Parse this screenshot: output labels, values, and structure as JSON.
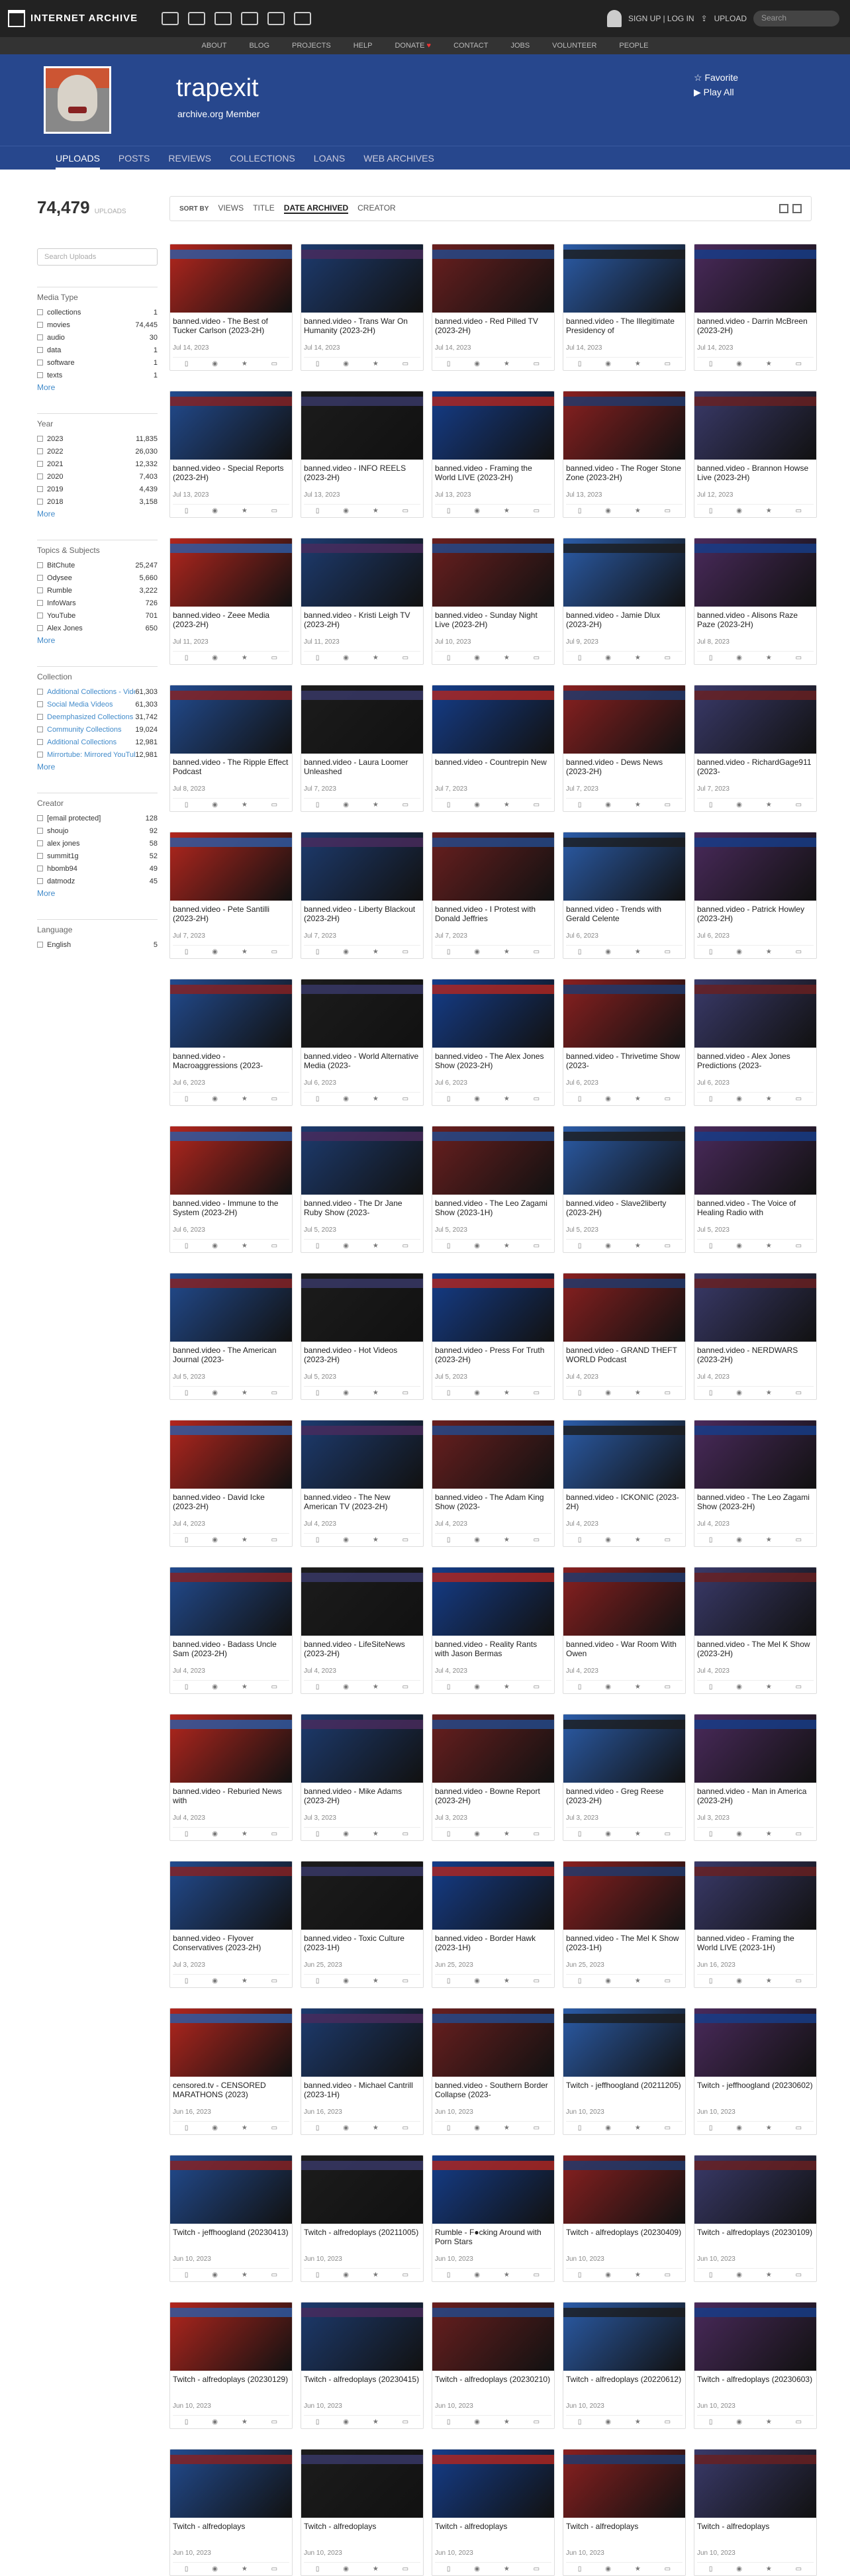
{
  "topnav": {
    "logo": "INTERNET ARCHIVE",
    "signup": "SIGN UP | LOG IN",
    "upload": "UPLOAD",
    "search_placeholder": "Search"
  },
  "subnav": [
    "ABOUT",
    "BLOG",
    "PROJECTS",
    "HELP",
    "DONATE",
    "CONTACT",
    "JOBS",
    "VOLUNTEER",
    "PEOPLE"
  ],
  "profile": {
    "name": "trapexit",
    "subtitle": "archive.org Member",
    "favorite": "☆ Favorite",
    "play_all": "▶ Play All"
  },
  "tabs": [
    "UPLOADS",
    "POSTS",
    "REVIEWS",
    "COLLECTIONS",
    "LOANS",
    "WEB ARCHIVES"
  ],
  "left": {
    "count": "74,479",
    "count_label": "UPLOADS",
    "search_placeholder": "Search Uploads",
    "facets": [
      {
        "title": "Media Type",
        "rows": [
          [
            "collections",
            "1"
          ],
          [
            "movies",
            "74,445"
          ],
          [
            "audio",
            "30"
          ],
          [
            "data",
            "1"
          ],
          [
            "software",
            "1"
          ],
          [
            "texts",
            "1"
          ]
        ],
        "more": "More"
      },
      {
        "title": "Year",
        "rows": [
          [
            "2023",
            "11,835"
          ],
          [
            "2022",
            "26,030"
          ],
          [
            "2021",
            "12,332"
          ],
          [
            "2020",
            "7,403"
          ],
          [
            "2019",
            "4,439"
          ],
          [
            "2018",
            "3,158"
          ]
        ],
        "more": "More"
      },
      {
        "title": "Topics & Subjects",
        "rows": [
          [
            "BitChute",
            "25,247"
          ],
          [
            "Odysee",
            "5,660"
          ],
          [
            "Rumble",
            "3,222"
          ],
          [
            "InfoWars",
            "726"
          ],
          [
            "YouTube",
            "701"
          ],
          [
            "Alex Jones",
            "650"
          ]
        ],
        "more": "More"
      },
      {
        "title": "Collection",
        "rows": [
          [
            "Additional Collections - Video",
            "61,303"
          ],
          [
            "Social Media Videos",
            "61,303"
          ],
          [
            "Deemphasized Collections",
            "31,742"
          ],
          [
            "Community Collections",
            "19,024"
          ],
          [
            "Additional Collections",
            "12,981"
          ],
          [
            "Mirrortube: Mirrored YouTube Videos",
            "12,981"
          ]
        ],
        "more": "More",
        "link": true
      },
      {
        "title": "Creator",
        "rows": [
          [
            "[email protected]",
            "128"
          ],
          [
            "shoujo",
            "92"
          ],
          [
            "alex jones",
            "58"
          ],
          [
            "summit1g",
            "52"
          ],
          [
            "hbomb94",
            "49"
          ],
          [
            "datmodz",
            "45"
          ]
        ],
        "more": "More"
      },
      {
        "title": "Language",
        "rows": [
          [
            "English",
            "5"
          ]
        ]
      }
    ]
  },
  "sortbar": {
    "label": "SORT BY",
    "options": [
      "VIEWS",
      "TITLE",
      "DATE ARCHIVED",
      "CREATOR"
    ],
    "active": "DATE ARCHIVED"
  },
  "items": [
    [
      "banned.video - The Best of Tucker Carlson (2023-2H)",
      "Jul 14, 2023"
    ],
    [
      "banned.video - Trans War On Humanity (2023-2H)",
      "Jul 14, 2023"
    ],
    [
      "banned.video - Red Pilled TV (2023-2H)",
      "Jul 14, 2023"
    ],
    [
      "banned.video - The Illegitimate Presidency of",
      "Jul 14, 2023"
    ],
    [
      "banned.video - Darrin McBreen (2023-2H)",
      "Jul 14, 2023"
    ],
    [
      "banned.video - Special Reports (2023-2H)",
      "Jul 13, 2023"
    ],
    [
      "banned.video - INFO REELS (2023-2H)",
      "Jul 13, 2023"
    ],
    [
      "banned.video - Framing the World LIVE (2023-2H)",
      "Jul 13, 2023"
    ],
    [
      "banned.video - The Roger Stone Zone (2023-2H)",
      "Jul 13, 2023"
    ],
    [
      "banned.video - Brannon Howse Live (2023-2H)",
      "Jul 12, 2023"
    ],
    [
      "banned.video - Zeee Media (2023-2H)",
      "Jul 11, 2023"
    ],
    [
      "banned.video - Kristi Leigh TV (2023-2H)",
      "Jul 11, 2023"
    ],
    [
      "banned.video - Sunday Night Live (2023-2H)",
      "Jul 10, 2023"
    ],
    [
      "banned.video - Jamie Dlux (2023-2H)",
      "Jul 9, 2023"
    ],
    [
      "banned.video - Alisons Raze Paze (2023-2H)",
      "Jul 8, 2023"
    ],
    [
      "banned.video - The Ripple Effect Podcast",
      "Jul 8, 2023"
    ],
    [
      "banned.video - Laura Loomer Unleashed",
      "Jul 7, 2023"
    ],
    [
      "banned.video - Countrepin New",
      "Jul 7, 2023"
    ],
    [
      "banned.video - Dews News (2023-2H)",
      "Jul 7, 2023"
    ],
    [
      "banned.video - RichardGage911 (2023-",
      "Jul 7, 2023"
    ],
    [
      "banned.video - Pete Santilli (2023-2H)",
      "Jul 7, 2023"
    ],
    [
      "banned.video - Liberty Blackout (2023-2H)",
      "Jul 7, 2023"
    ],
    [
      "banned.video - I Protest with Donald Jeffries",
      "Jul 7, 2023"
    ],
    [
      "banned.video - Trends with Gerald Celente",
      "Jul 6, 2023"
    ],
    [
      "banned.video - Patrick Howley (2023-2H)",
      "Jul 6, 2023"
    ],
    [
      "banned.video - Macroaggressions (2023-",
      "Jul 6, 2023"
    ],
    [
      "banned.video - World Alternative Media (2023-",
      "Jul 6, 2023"
    ],
    [
      "banned.video - The Alex Jones Show (2023-2H)",
      "Jul 6, 2023"
    ],
    [
      "banned.video - Thrivetime Show (2023-",
      "Jul 6, 2023"
    ],
    [
      "banned.video - Alex Jones Predictions (2023-",
      "Jul 6, 2023"
    ],
    [
      "banned.video - Immune to the System (2023-2H)",
      "Jul 6, 2023"
    ],
    [
      "banned.video - The Dr Jane Ruby Show (2023-",
      "Jul 5, 2023"
    ],
    [
      "banned.video - The Leo Zagami Show (2023-1H)",
      "Jul 5, 2023"
    ],
    [
      "banned.video - Slave2liberty (2023-2H)",
      "Jul 5, 2023"
    ],
    [
      "banned.video - The Voice of Healing Radio with",
      "Jul 5, 2023"
    ],
    [
      "banned.video - The American Journal (2023-",
      "Jul 5, 2023"
    ],
    [
      "banned.video - Hot Videos (2023-2H)",
      "Jul 5, 2023"
    ],
    [
      "banned.video - Press For Truth (2023-2H)",
      "Jul 5, 2023"
    ],
    [
      "banned.video - GRAND THEFT WORLD Podcast",
      "Jul 4, 2023"
    ],
    [
      "banned.video - NERDWARS (2023-2H)",
      "Jul 4, 2023"
    ],
    [
      "banned.video - David Icke (2023-2H)",
      "Jul 4, 2023"
    ],
    [
      "banned.video - The New American TV (2023-2H)",
      "Jul 4, 2023"
    ],
    [
      "banned.video - The Adam King Show (2023-",
      "Jul 4, 2023"
    ],
    [
      "banned.video - ICKONIC (2023-2H)",
      "Jul 4, 2023"
    ],
    [
      "banned.video - The Leo Zagami Show (2023-2H)",
      "Jul 4, 2023"
    ],
    [
      "banned.video - Badass Uncle Sam (2023-2H)",
      "Jul 4, 2023"
    ],
    [
      "banned.video - LifeSiteNews (2023-2H)",
      "Jul 4, 2023"
    ],
    [
      "banned.video - Reality Rants with Jason Bermas",
      "Jul 4, 2023"
    ],
    [
      "banned.video - War Room With Owen",
      "Jul 4, 2023"
    ],
    [
      "banned.video - The Mel K Show (2023-2H)",
      "Jul 4, 2023"
    ],
    [
      "banned.video - Reburied News with",
      "Jul 4, 2023"
    ],
    [
      "banned.video - Mike Adams (2023-2H)",
      "Jul 3, 2023"
    ],
    [
      "banned.video - Bowne Report (2023-2H)",
      "Jul 3, 2023"
    ],
    [
      "banned.video - Greg Reese (2023-2H)",
      "Jul 3, 2023"
    ],
    [
      "banned.video - Man in America (2023-2H)",
      "Jul 3, 2023"
    ],
    [
      "banned.video - Flyover Conservatives (2023-2H)",
      "Jul 3, 2023"
    ],
    [
      "banned.video - Toxic Culture (2023-1H)",
      "Jun 25, 2023"
    ],
    [
      "banned.video - Border Hawk (2023-1H)",
      "Jun 25, 2023"
    ],
    [
      "banned.video - The Mel K Show (2023-1H)",
      "Jun 25, 2023"
    ],
    [
      "banned.video - Framing the World LIVE (2023-1H)",
      "Jun 16, 2023"
    ],
    [
      "censored.tv - CENSORED MARATHONS (2023)",
      "Jun 16, 2023"
    ],
    [
      "banned.video - Michael Cantrill (2023-1H)",
      "Jun 16, 2023"
    ],
    [
      "banned.video - Southern Border Collapse (2023-",
      "Jun 10, 2023"
    ],
    [
      "Twitch - jeffhoogland (20211205)",
      "Jun 10, 2023"
    ],
    [
      "Twitch - jeffhoogland (20230602)",
      "Jun 10, 2023"
    ],
    [
      "Twitch - jeffhoogland (20230413)",
      "Jun 10, 2023"
    ],
    [
      "Twitch - alfredoplays (20211005)",
      "Jun 10, 2023"
    ],
    [
      "Rumble - F●cking Around with Porn Stars",
      "Jun 10, 2023"
    ],
    [
      "Twitch - alfredoplays (20230409)",
      "Jun 10, 2023"
    ],
    [
      "Twitch - alfredoplays (20230109)",
      "Jun 10, 2023"
    ],
    [
      "Twitch - alfredoplays (20230129)",
      "Jun 10, 2023"
    ],
    [
      "Twitch - alfredoplays (20230415)",
      "Jun 10, 2023"
    ],
    [
      "Twitch - alfredoplays (20230210)",
      "Jun 10, 2023"
    ],
    [
      "Twitch - alfredoplays (20220612)",
      "Jun 10, 2023"
    ],
    [
      "Twitch - alfredoplays (20230603)",
      "Jun 10, 2023"
    ],
    [
      "Twitch - alfredoplays",
      "Jun 10, 2023"
    ],
    [
      "Twitch - alfredoplays",
      "Jun 10, 2023"
    ],
    [
      "Twitch - alfredoplays",
      "Jun 10, 2023"
    ],
    [
      "Twitch - alfredoplays",
      "Jun 10, 2023"
    ],
    [
      "Twitch - alfredoplays",
      "Jun 10, 2023"
    ]
  ],
  "thumb_colors": [
    "#b3261e",
    "#1d3b6f",
    "#6a1f1f",
    "#2b5ca8",
    "#4a2a5c",
    "#224b8f",
    "#1c1c1c",
    "#153d8a",
    "#8a2020",
    "#3a3a6a"
  ]
}
